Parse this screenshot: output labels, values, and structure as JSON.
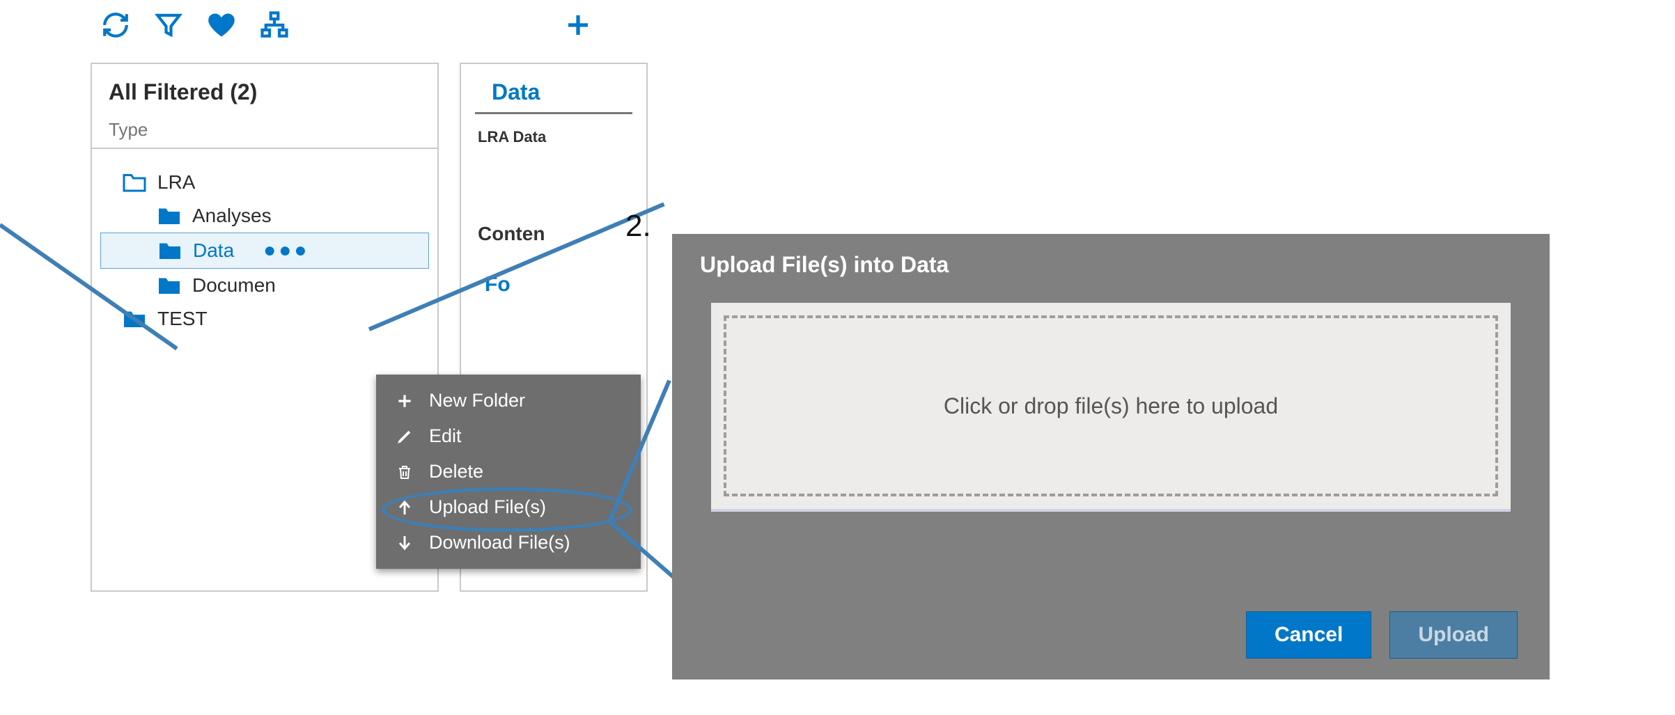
{
  "toolbar": {
    "icons": [
      "refresh-icon",
      "filter-icon",
      "heart-icon",
      "tree-icon",
      "plus-icon"
    ]
  },
  "tree": {
    "title": "All Filtered (2)",
    "type_placeholder": "Type",
    "items": [
      {
        "label": "LRA",
        "style": "outline"
      },
      {
        "label": "Analyses",
        "style": "solid"
      },
      {
        "label": "Data",
        "style": "solid",
        "selected": true
      },
      {
        "label": "Documen",
        "style": "solid"
      },
      {
        "label": "TEST",
        "style": "solid"
      }
    ],
    "dots": "●●●"
  },
  "detail": {
    "heading": "Data",
    "sub": "LRA Data",
    "content": "Conten",
    "folder": "Fo"
  },
  "context_menu": {
    "items": [
      {
        "label": "New Folder",
        "icon": "plus-icon"
      },
      {
        "label": "Edit",
        "icon": "pencil-icon"
      },
      {
        "label": "Delete",
        "icon": "trash-icon"
      },
      {
        "label": "Upload File(s)",
        "icon": "arrow-up-icon"
      },
      {
        "label": "Download File(s)",
        "icon": "arrow-down-icon"
      }
    ]
  },
  "step_label": "2.",
  "modal": {
    "title": "Upload File(s) into Data",
    "drop_text": "Click or drop file(s) here to upload",
    "cancel": "Cancel",
    "upload": "Upload"
  },
  "colors": {
    "accent": "#0077C8",
    "menu_bg": "#6E6E6E",
    "modal_bg": "#808080"
  }
}
